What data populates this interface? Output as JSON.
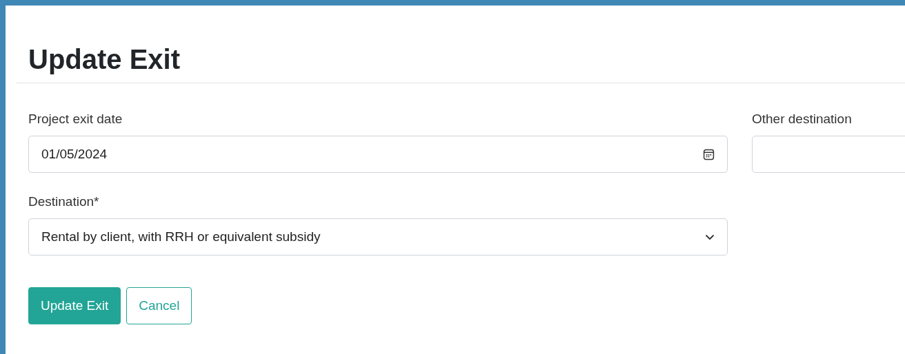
{
  "title": "Update Exit",
  "fields": [
    {
      "kind": "date",
      "label": "Project exit date",
      "value": "01/05/2024"
    },
    {
      "kind": "text",
      "label": "Other destination"
    },
    {
      "kind": "select",
      "label": "Destination*",
      "value": "Rental by client, with RRH or equivalent subsidy"
    }
  ],
  "buttons": [
    {
      "label": "Update Exit",
      "kind": "primary"
    },
    {
      "label": "Cancel",
      "kind": "outline"
    }
  ]
}
